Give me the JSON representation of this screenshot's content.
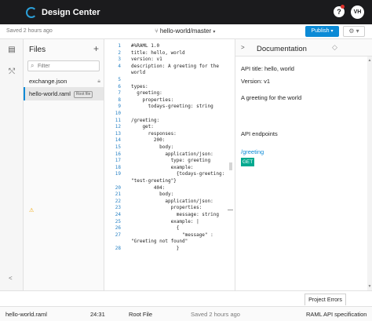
{
  "topbar": {
    "title": "Design Center",
    "help_label": "?",
    "avatar_initials": "VH"
  },
  "subbar": {
    "saved": "Saved 2 hours ago",
    "branch": "hello-world/master",
    "publish": "Publish",
    "settings": "⚙ ▾"
  },
  "files": {
    "title": "Files",
    "filter_placeholder": "Filter",
    "items": [
      {
        "name": "exchange.json"
      },
      {
        "name": "hello-world.raml",
        "badge": "Root file"
      }
    ]
  },
  "editor": {
    "lines": [
      {
        "n": "1",
        "text": "#%RAML 1.0"
      },
      {
        "n": "2",
        "text": "title: hello, world"
      },
      {
        "n": "3",
        "text": "version: v1"
      },
      {
        "n": "4",
        "text": "description: A greeting for the"
      },
      {
        "n": "",
        "text": "world"
      },
      {
        "n": "5",
        "text": ""
      },
      {
        "n": "6",
        "text": "types:"
      },
      {
        "n": "7",
        "text": "  greeting:"
      },
      {
        "n": "8",
        "text": "    properties:"
      },
      {
        "n": "9",
        "text": "      todays-greeting: string"
      },
      {
        "n": "10",
        "text": ""
      },
      {
        "n": "11",
        "text": "/greeting:"
      },
      {
        "n": "12",
        "text": "    get:"
      },
      {
        "n": "13",
        "text": "      responses:"
      },
      {
        "n": "14",
        "text": "        200:"
      },
      {
        "n": "15",
        "text": "          body:"
      },
      {
        "n": "16",
        "text": "            application/json:"
      },
      {
        "n": "17",
        "text": "              type: greeting"
      },
      {
        "n": "18",
        "text": "              example:"
      },
      {
        "n": "19",
        "text": "                {todays-greeting:"
      },
      {
        "n": "",
        "text": "\"test-greeting\"}"
      },
      {
        "n": "20",
        "text": "        404:"
      },
      {
        "n": "21",
        "text": "          body:"
      },
      {
        "n": "22",
        "text": "            application/json:"
      },
      {
        "n": "23",
        "text": "              properties:"
      },
      {
        "n": "24",
        "text": "                message: string"
      },
      {
        "n": "25",
        "text": "              example: |"
      },
      {
        "n": "26",
        "text": "                {"
      },
      {
        "n": "27",
        "text": "                  \"message\" :"
      },
      {
        "n": "",
        "text": "\"Greeting not found\""
      },
      {
        "n": "28",
        "text": "                }"
      }
    ],
    "warning_line": "24"
  },
  "docs": {
    "title": "Documentation",
    "api_title": "API title: hello, world",
    "version": "Version: v1",
    "description": "A greeting for the world",
    "endpoints_heading": "API endpoints",
    "endpoint": "/greeting",
    "method": "GET"
  },
  "bottom": {
    "problems_tab": "Project Errors"
  },
  "status": {
    "file": "hello-world.raml",
    "position": "24:31",
    "file_type": "Root File",
    "saved": "Saved 2 hours ago",
    "language": "RAML",
    "spec_type": "API specification"
  },
  "colors": {
    "topbar": "#1b1b1d",
    "accent": "#0b8ad6",
    "get_badge": "#00a98f",
    "line_number": "#2580c4"
  }
}
